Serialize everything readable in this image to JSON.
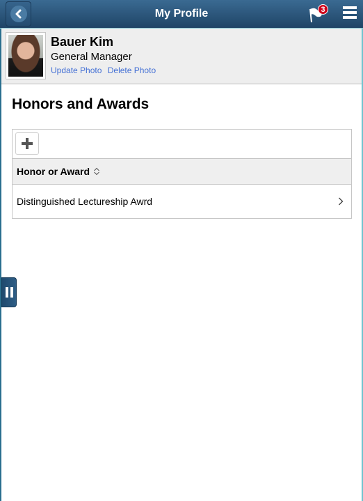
{
  "header": {
    "title": "My Profile",
    "back_icon": "chevron-left-icon",
    "notification_icon": "flag-icon",
    "notification_count": "3",
    "menu_icon": "hamburger-menu-icon"
  },
  "profile": {
    "name": "Bauer Kim",
    "job_title": "General Manager",
    "update_photo_label": "Update Photo",
    "delete_photo_label": "Delete Photo"
  },
  "section": {
    "title": "Honors and Awards",
    "add_icon": "plus-icon",
    "column_header": "Honor or Award",
    "sort_icon": "sort-updown-icon",
    "rows": [
      {
        "label": "Distinguished Lectureship Awrd"
      }
    ]
  },
  "side_handle_icon": "pause-handle-icon",
  "colors": {
    "header_top": "#3a6a92",
    "header_bottom": "#1f4466",
    "link": "#4571d5",
    "badge": "#d0021b"
  }
}
